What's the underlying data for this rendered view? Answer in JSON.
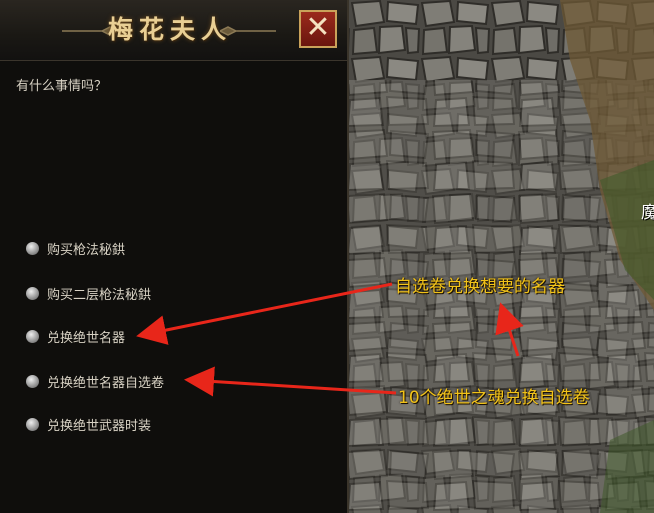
{
  "dialog": {
    "title": "梅花夫人",
    "close_glyph": "✕",
    "greeting": "有什么事情吗？",
    "options": [
      {
        "label": "购买枪法秘鉷",
        "icon": "radio-bullet-icon"
      },
      {
        "label": "购买二层枪法秘鉷",
        "icon": "radio-bullet-icon"
      },
      {
        "label": "兑换绝世名器",
        "icon": "radio-bullet-icon"
      },
      {
        "label": "兑换绝世名器自选卷",
        "icon": "radio-bullet-icon"
      },
      {
        "label": "兑换绝世武器时装",
        "icon": "radio-bullet-icon"
      }
    ]
  },
  "annotations": {
    "note1": "自选卷兑换想要的名器",
    "note2": "10个绝世之魂兑换自选卷",
    "arrow_color": "#e8261a",
    "text_color": "#f2c319"
  },
  "scene": {
    "edge_char": "魔"
  },
  "colors": {
    "panel_bg": "#0f0e0c",
    "title_gold": "#e9cf94",
    "close_red": "#8a2216"
  }
}
